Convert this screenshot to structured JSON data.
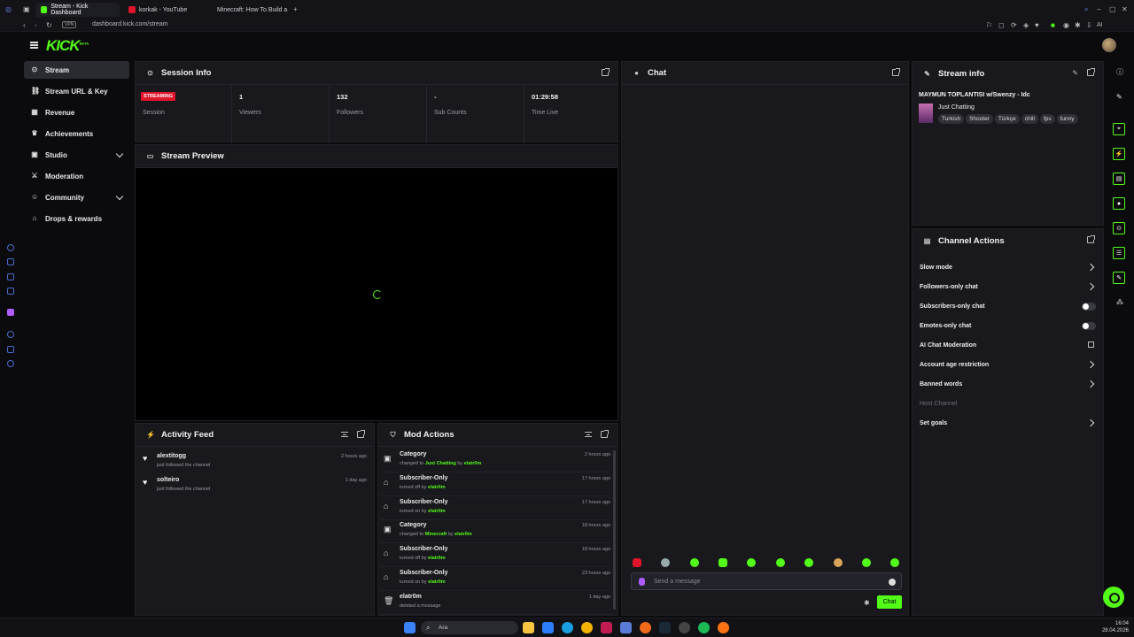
{
  "browser": {
    "tabs": [
      {
        "title": "Stream - Kick Dashboard",
        "active": true
      },
      {
        "title": "korkak - YouTube",
        "active": false
      },
      {
        "title": "Minecraft: How To Build a",
        "active": false
      }
    ],
    "vpn_label": "VPN",
    "url": "dashboard.kick.com/stream",
    "ai_label": "AI"
  },
  "app": {
    "logo": "KICK",
    "logo_sup": "BETA"
  },
  "sidebar": {
    "items": [
      {
        "label": "Stream",
        "icon": "broadcast-icon",
        "active": true
      },
      {
        "label": "Stream URL & Key",
        "icon": "link-icon"
      },
      {
        "label": "Revenue",
        "icon": "chart-icon"
      },
      {
        "label": "Achievements",
        "icon": "trophy-icon"
      },
      {
        "label": "Studio",
        "icon": "window-icon",
        "expandable": true
      },
      {
        "label": "Moderation",
        "icon": "sword-icon"
      },
      {
        "label": "Community",
        "icon": "people-icon",
        "expandable": true
      },
      {
        "label": "Drops & rewards",
        "icon": "gift-icon"
      }
    ]
  },
  "session": {
    "title": "Session Info",
    "badge": "STREAMING",
    "stats": [
      {
        "value": "",
        "label": "Session"
      },
      {
        "value": "1",
        "label": "Viewers"
      },
      {
        "value": "132",
        "label": "Followers"
      },
      {
        "value": "-",
        "label": "Sub Counts"
      },
      {
        "value": "01:29:58",
        "label": "Time Live"
      }
    ]
  },
  "preview": {
    "title": "Stream Preview"
  },
  "activity": {
    "title": "Activity Feed",
    "items": [
      {
        "name": "alextitogg",
        "sub": "just followed the channel",
        "time": "2 hours ago"
      },
      {
        "name": "solteiro",
        "sub": "just followed the channel",
        "time": "1 day ago"
      }
    ]
  },
  "mod": {
    "title": "Mod Actions",
    "items": [
      {
        "name": "Category",
        "pre": "changed to ",
        "hl": "Just Chatting",
        "mid": " by ",
        "user": "elatr0m",
        "time": "2 hours ago",
        "icon": "category-icon"
      },
      {
        "name": "Subscriber-Only",
        "pre": "turned off by ",
        "hl": "",
        "mid": "",
        "user": "elatr0m",
        "time": "17 hours ago",
        "icon": "gift-icon"
      },
      {
        "name": "Subscriber-Only",
        "pre": "turned on by ",
        "hl": "",
        "mid": "",
        "user": "elatr0m",
        "time": "17 hours ago",
        "icon": "gift-icon"
      },
      {
        "name": "Category",
        "pre": "changed to ",
        "hl": "Minecraft",
        "mid": " by ",
        "user": "elatr0m",
        "time": "18 hours ago",
        "icon": "category-icon"
      },
      {
        "name": "Subscriber-Only",
        "pre": "turned off by ",
        "hl": "",
        "mid": "",
        "user": "elatr0m",
        "time": "18 hours ago",
        "icon": "gift-icon"
      },
      {
        "name": "Subscriber-Only",
        "pre": "turned on by ",
        "hl": "",
        "mid": "",
        "user": "elatr0m",
        "time": "23 hours ago",
        "icon": "gift-icon"
      },
      {
        "name": "elatr0m",
        "pre": "deleted a message",
        "hl": "",
        "mid": "",
        "user": "",
        "time": "1 day ago",
        "icon": "trash-icon"
      }
    ]
  },
  "chat": {
    "title": "Chat",
    "placeholder": "Send a message",
    "send_label": "Chat"
  },
  "stream_info": {
    "title": "Stream info",
    "stream_title": "MAYMUN TOPLANTISI w/Swenzy - Idc",
    "category": "Just Chatting",
    "tags": [
      "Turkish",
      "Shooter",
      "Türkçe",
      "chill",
      "fps",
      "funny"
    ]
  },
  "channel_actions": {
    "title": "Channel Actions",
    "rows": [
      {
        "label": "Slow mode",
        "control": "arrow"
      },
      {
        "label": "Followers-only chat",
        "control": "arrow"
      },
      {
        "label": "Subscribers-only chat",
        "control": "toggle"
      },
      {
        "label": "Emotes-only chat",
        "control": "toggle"
      },
      {
        "label": "AI Chat Moderation",
        "control": "external"
      },
      {
        "label": "Account age restriction",
        "control": "arrow"
      },
      {
        "label": "Banned words",
        "control": "arrow"
      },
      {
        "label": "Host Channel",
        "control": "none",
        "muted": true
      },
      {
        "label": "Set goals",
        "control": "arrow"
      }
    ]
  },
  "taskbar": {
    "search": "Ara",
    "time": "16:04",
    "date": "28.04.2026"
  },
  "colors": {
    "accent": "#53fc18",
    "live": "#e0142a",
    "panel": "#18181d",
    "bg": "#0b0b0e"
  }
}
